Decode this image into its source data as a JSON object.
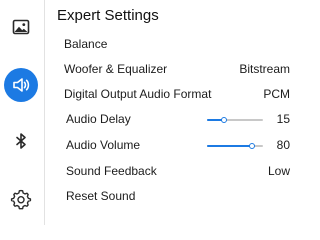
{
  "sidebar": {
    "items": [
      {
        "icon": "picture-icon",
        "active": false
      },
      {
        "icon": "speaker-icon",
        "active": true
      },
      {
        "icon": "bluetooth-icon",
        "active": false
      },
      {
        "icon": "gear-icon",
        "active": false
      }
    ]
  },
  "panel": {
    "title": "Expert Settings",
    "rows": {
      "balance": {
        "label": "Balance"
      },
      "woofer": {
        "label": "Woofer & Equalizer",
        "value": "Bitstream"
      },
      "digital_output": {
        "label": "Digital Output Audio Format",
        "value": "PCM"
      },
      "audio_delay": {
        "label": "Audio Delay",
        "value": "15",
        "level": 0.3
      },
      "audio_volume": {
        "label": "Audio Volume",
        "value": "80",
        "level": 0.8
      },
      "sound_feedback": {
        "label": "Sound Feedback",
        "value": "Low"
      },
      "reset_sound": {
        "label": "Reset Sound"
      }
    }
  },
  "colors": {
    "accent": "#1c7ae3",
    "track": "#c8c8c8"
  }
}
